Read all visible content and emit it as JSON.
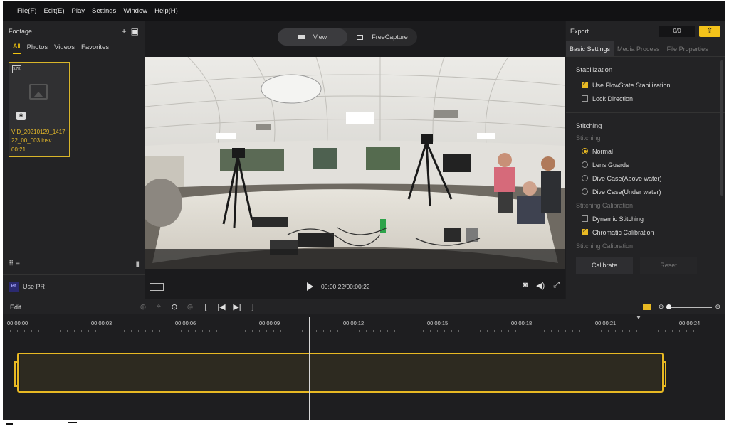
{
  "menu": [
    "File(F)",
    "Edit(E)",
    "Play",
    "Settings",
    "Window",
    "Help(H)"
  ],
  "footage": {
    "title": "Footage",
    "tabs": [
      "All",
      "Photos",
      "Videos",
      "Favorites"
    ],
    "clip": {
      "badge": "5.7K",
      "name": "VID_20210129_141722_00_003.insv",
      "duration": "00:21"
    },
    "use_pr": "Use PR",
    "pr_badge": "Pr"
  },
  "viewer": {
    "view_label": "View",
    "freecapture_label": "FreeCapture",
    "time": "00:00:22/00:00:22"
  },
  "export": {
    "title": "Export",
    "count": "0/0",
    "tabs": [
      "Basic Settings",
      "Media Process",
      "File Properties"
    ],
    "stabilization": {
      "title": "Stabilization",
      "use_flowstate": "Use FlowState Stabilization",
      "lock_direction": "Lock Direction"
    },
    "stitching": {
      "title": "Stitching",
      "sub": "Stitching",
      "options": [
        "Normal",
        "Lens Guards",
        "Dive Case(Above water)",
        "Dive Case(Under water)"
      ],
      "calibration_title": "Stitching Calibration",
      "dynamic": "Dynamic Stitching",
      "chromatic": "Chromatic Calibration",
      "calibration_title2": "Stitching Calibration",
      "calibrate": "Calibrate",
      "reset": "Reset"
    }
  },
  "timeline": {
    "edit_label": "Edit",
    "ticks": [
      "00:00:00",
      "00:00:03",
      "00:00:06",
      "00:00:09",
      "00:00:12",
      "00:00:15",
      "00:00:18",
      "00:00:21",
      "00:00:24"
    ]
  },
  "colors": {
    "accent": "#e8b923",
    "panel": "#232325",
    "background": "#1d1d1f"
  }
}
